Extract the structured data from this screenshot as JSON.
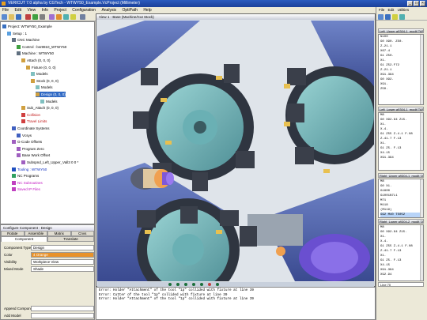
{
  "window": {
    "title": "VERICUT 7.0 alpha by CGTech - WTWY50_Example.VcProject (Millimeter)"
  },
  "menu": [
    "File",
    "Edit",
    "View",
    "Info",
    "Project",
    "Configuration",
    "Analysis",
    "OptiPath",
    "Help"
  ],
  "project_tree": {
    "items": [
      {
        "label": "Project: WTWY50_Example",
        "indent": 0,
        "style": "",
        "icon": "project-icon"
      },
      {
        "label": "Setup : 1",
        "indent": 1,
        "style": "",
        "icon": "setup-icon"
      },
      {
        "label": "CNC Machine",
        "indent": 2,
        "style": "",
        "icon": "machine-icon"
      },
      {
        "label": "Control : bsr8910_WTWY50",
        "indent": 3,
        "style": "",
        "icon": "control-icon"
      },
      {
        "label": "Machine : WTWY50",
        "indent": 3,
        "style": "",
        "icon": "machine-icon"
      },
      {
        "label": "Attach (0, 0, 0)",
        "indent": 4,
        "style": "",
        "icon": "component-icon"
      },
      {
        "label": "Fixture (0, 0, 0)",
        "indent": 5,
        "style": "",
        "icon": "component-icon"
      },
      {
        "label": "Models",
        "indent": 6,
        "style": "",
        "icon": "models-icon"
      },
      {
        "label": "Stock (0, 0, 0)",
        "indent": 6,
        "style": "",
        "icon": "component-icon"
      },
      {
        "label": "Models",
        "indent": 7,
        "style": "",
        "icon": "models-icon"
      },
      {
        "label": "Design (0, 0, 0)",
        "indent": 7,
        "style": "sel",
        "icon": "component-icon"
      },
      {
        "label": "Models",
        "indent": 8,
        "style": "",
        "icon": "models-icon"
      },
      {
        "label": "Sub_Attach (0, 0, 0)",
        "indent": 4,
        "style": "",
        "icon": "component-icon"
      },
      {
        "label": "Collision",
        "indent": 4,
        "style": "red",
        "icon": "collision-icon"
      },
      {
        "label": "Travel Limits",
        "indent": 4,
        "style": "red",
        "icon": "limits-icon"
      },
      {
        "label": "Coordinate Systems",
        "indent": 2,
        "style": "",
        "icon": "csys-icon"
      },
      {
        "label": "Vcsys",
        "indent": 3,
        "style": "",
        "icon": "csys-icon"
      },
      {
        "label": "G-Code Offsets",
        "indent": 2,
        "style": "",
        "icon": "offsets-icon"
      },
      {
        "label": "Program Zero",
        "indent": 3,
        "style": "",
        "icon": "offsets-icon"
      },
      {
        "label": "Base Work Offset",
        "indent": 3,
        "style": "",
        "icon": "offsets-icon"
      },
      {
        "label": "Subspnd_Left_Upper_Vall3 0 0 *",
        "indent": 4,
        "style": "",
        "icon": "offsets-icon"
      },
      {
        "label": "Tooling : WTWY50",
        "indent": 2,
        "style": "blu",
        "icon": "tooling-icon"
      },
      {
        "label": "NC Programs",
        "indent": 2,
        "style": "",
        "icon": "ncprog-icon"
      },
      {
        "label": "NC Subroutines",
        "indent": 2,
        "style": "mag",
        "icon": "ncsub-icon"
      },
      {
        "label": "Saved IP Files",
        "indent": 2,
        "style": "mag",
        "icon": "ipfile-icon"
      }
    ]
  },
  "config": {
    "title": "Configure Component : Design",
    "tabs": [
      "Rotate",
      "Assemble",
      "Matrix",
      "Cnvs"
    ],
    "subtabs": [
      "Component",
      "Translate"
    ],
    "props": [
      {
        "key": "Component Type",
        "value": "Design"
      },
      {
        "key": "Color",
        "value": "4 Orange"
      },
      {
        "key": "Visibility",
        "value": "Workpiece View"
      },
      {
        "key": "Mixed Mode",
        "value": "Shade"
      }
    ],
    "buttons": [
      "Append Component",
      "Add Model"
    ]
  },
  "view": {
    "title": "View 1 - Base (Machine/Cut Stock)"
  },
  "console": {
    "lines": [
      "Error: Holder \"Attachment\" of the tool \"1p\" collided with fixture at line 39",
      "Error: Cutter of the tool \"1p\" collided with fixture at line 39",
      "Error: Holder \"Attachment\" of the tool \"1p\" collided with fixture at line 39"
    ]
  },
  "right_panel": {
    "menu": [
      "File",
      "Edit",
      "Utilities"
    ],
    "windows": [
      {
        "title": "Left_Upper a9304-1_modif.TAP",
        "lines": [
          "N100",
          "G0 X90. Z50.",
          "Z-21.1",
          "X67.4",
          "G1 Z50.",
          "X1.",
          "G1 Z52.F72",
          "Z-21.1",
          "X91.394",
          "G0 X92.",
          "X91.",
          "Z50."
        ]
      },
      {
        "title": "Left_Lower a9304-1_modif.TAP",
        "lines": [
          "M8",
          "G0 X92.94 Z15.",
          "X1.",
          "X-4.",
          "G1 Z55 Z-4.1 F.08",
          "Z-41.7 F.13",
          "X1.",
          "G1 Z5. F.13",
          "X4.15",
          "X91.394"
        ]
      },
      {
        "title": "Right_Upper a9304-1_modif.TAP",
        "lines": [
          "M8",
          "G0 X1.",
          "G1800",
          "G1001N7L1",
          "M71",
          "M118",
          "(M119)",
          "G92 M40 T5052"
        ],
        "highlight": 7
      },
      {
        "title": "Right_Lower a9304-2_modif.TAP",
        "lines": [
          "M8",
          "G0 X92.94 Z15.",
          "X1.",
          "X-4.",
          "G1 Z55 Z-4.1 F.08",
          "Z-41.7 F.13",
          "X1.",
          "G1 Z5. F.13",
          "X4.15",
          "X91.394",
          "X92.94"
        ]
      }
    ],
    "footer": "Line 70"
  },
  "colors": {
    "bg": "#dfe4ea",
    "metal": "#7fbfc0",
    "dark": "#3a3f4a",
    "purple": "#6a4fd0",
    "orange": "#e8922a",
    "blue": "#2060c0"
  }
}
